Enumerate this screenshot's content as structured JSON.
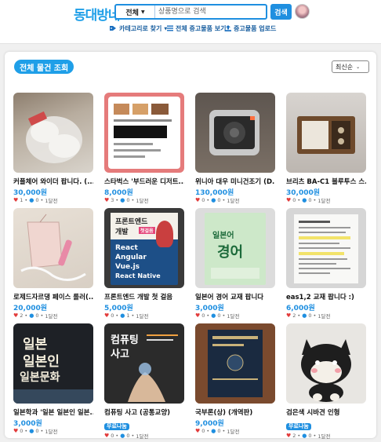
{
  "header": {
    "logo": "동대방네",
    "search_category": "전체",
    "search_placeholder": "상품명으로 검색",
    "search_button": "검색"
  },
  "subnav": {
    "category": "카테고리로 찾기",
    "all_items": "전체 중고물품 보기",
    "upload": "중고물품 업로드"
  },
  "main": {
    "title": "전체 물건 조회",
    "sort": "최신순"
  },
  "products": [
    {
      "title": "커플체어 와이더 팝니다. (...",
      "price": "30,000원",
      "likes": "1",
      "comments": "0",
      "time": "1달전",
      "badge": ""
    },
    {
      "title": "스타벅스 '부드러운 디저트...",
      "price": "8,000원",
      "likes": "3",
      "comments": "0",
      "time": "1달전",
      "badge": ""
    },
    {
      "title": "위니아 대우 미니건조기 (D...",
      "price": "130,000원",
      "likes": "0",
      "comments": "0",
      "time": "1달전",
      "badge": ""
    },
    {
      "title": "브리츠 BA-C1 블루투스 스...",
      "price": "30,000원",
      "likes": "0",
      "comments": "0",
      "time": "1달전",
      "badge": ""
    },
    {
      "title": "로제드자르댕 페이스 롤러(...",
      "price": "20,000원",
      "likes": "2",
      "comments": "0",
      "time": "1달전",
      "badge": ""
    },
    {
      "title": "프론트엔드 개발 첫 걸음",
      "price": "5,000원",
      "likes": "0",
      "comments": "1",
      "time": "1달전",
      "badge": ""
    },
    {
      "title": "일본어 경어 교재 팝니다",
      "price": "3,000원",
      "likes": "0",
      "comments": "0",
      "time": "1달전",
      "badge": ""
    },
    {
      "title": "eas1,2 교재 팝니다 :)",
      "price": "6,000원",
      "likes": "2",
      "comments": "0",
      "time": "1달전",
      "badge": ""
    },
    {
      "title": "일본학과 '일본 일본인 일본...",
      "price": "3,000원",
      "likes": "0",
      "comments": "0",
      "time": "1달전",
      "badge": ""
    },
    {
      "title": "컴퓨팅 사고 (공통교양)",
      "price": "",
      "likes": "0",
      "comments": "0",
      "time": "1달전",
      "badge": "무료나눔"
    },
    {
      "title": "국부론(상) (개역판)",
      "price": "9,000원",
      "likes": "0",
      "comments": "0",
      "time": "1달전",
      "badge": ""
    },
    {
      "title": "검은색 시바견 인형",
      "price": "",
      "likes": "2",
      "comments": "0",
      "time": "1달전",
      "badge": "무료나눔"
    }
  ],
  "thumb_texts": {
    "frontend_1": "프론트엔드",
    "frontend_2": "개발",
    "frontend_3": "첫걸음",
    "frontend_4": "React",
    "frontend_5": "Angular",
    "frontend_6": "Vue.js",
    "frontend_7": "React Native",
    "keigo_1": "일본어",
    "keigo_2": "경어",
    "japan_1": "일본",
    "japan_2": "일본인",
    "japan_3": "일본문화",
    "computing_1": "컴퓨팅",
    "computing_2": "사고"
  }
}
